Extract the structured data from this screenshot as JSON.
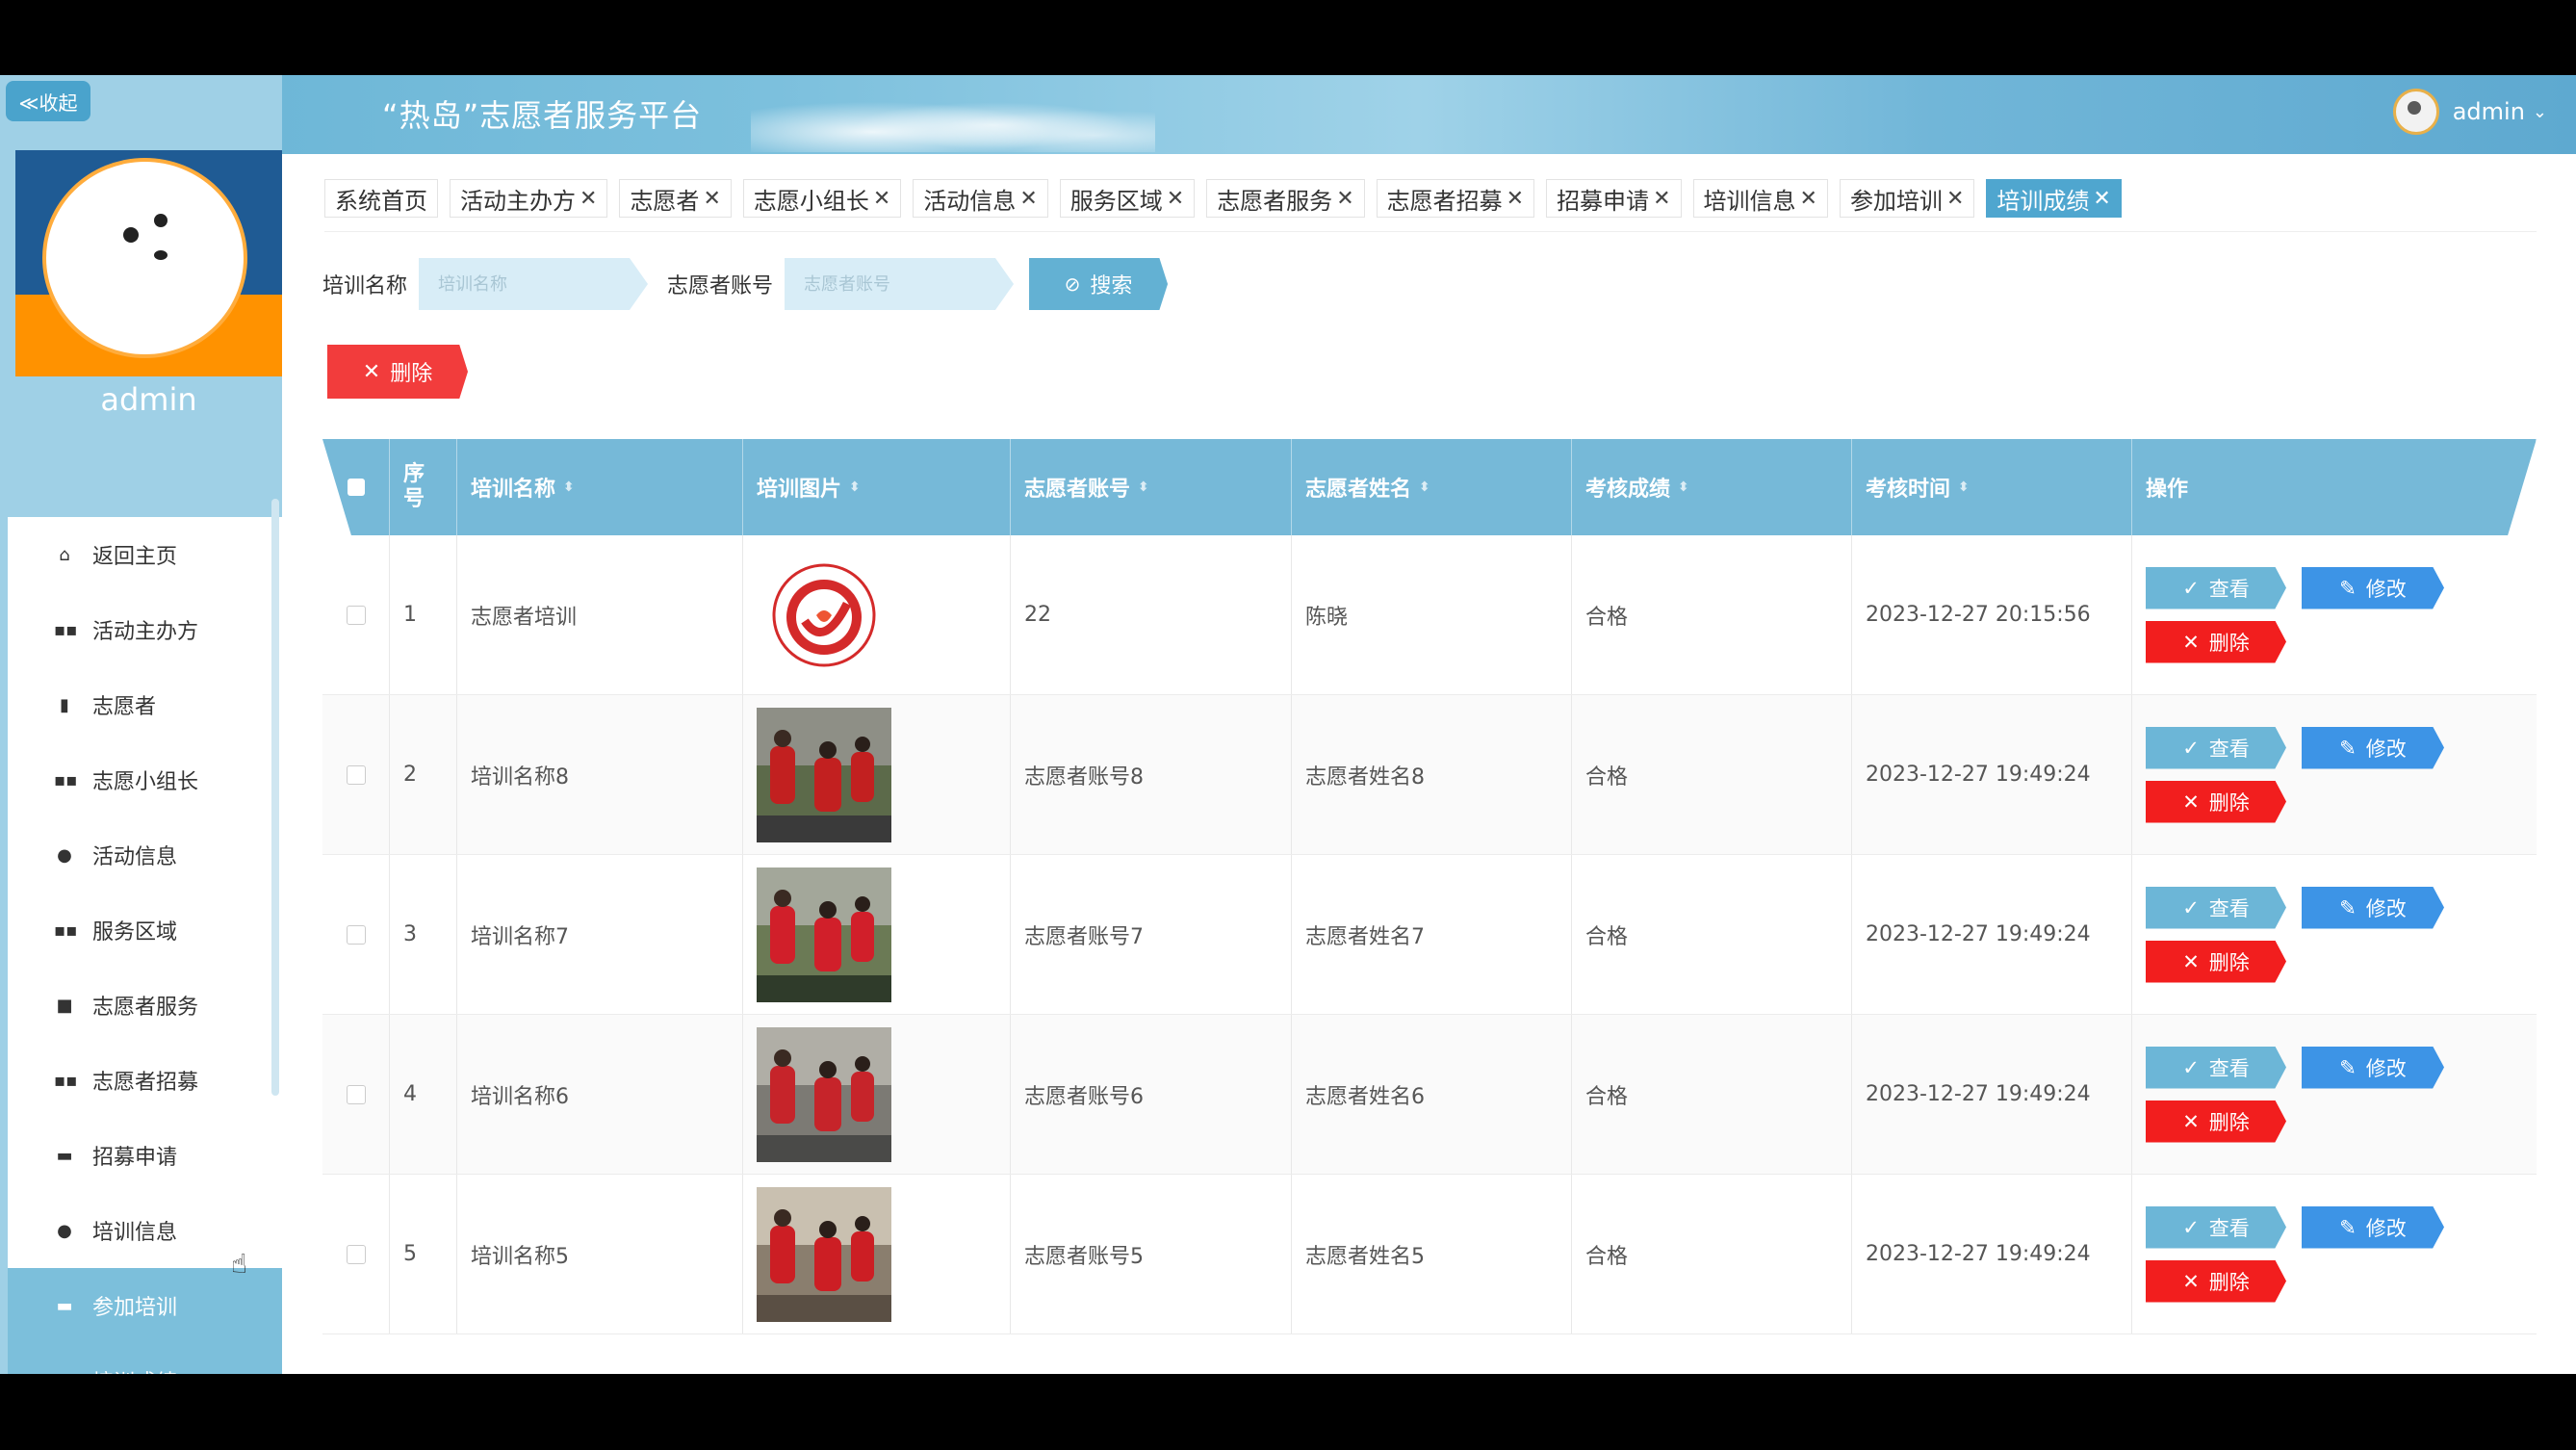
{
  "collapse_label": "≪收起",
  "brand": "“热岛”志愿者服务平台",
  "user": {
    "name": "admin",
    "caret": "⌄"
  },
  "sidebar": {
    "admin_name": "admin",
    "items": [
      {
        "label": "返回主页",
        "icon": "home-icon",
        "glyph": "⌂"
      },
      {
        "label": "活动主办方",
        "icon": "grid-icon",
        "glyph": "▪▪"
      },
      {
        "label": "志愿者",
        "icon": "chart-icon",
        "glyph": "▮"
      },
      {
        "label": "志愿小组长",
        "icon": "grid-icon",
        "glyph": "▪▪"
      },
      {
        "label": "活动信息",
        "icon": "pin-icon",
        "glyph": "●"
      },
      {
        "label": "服务区域",
        "icon": "grid-icon",
        "glyph": "▪▪"
      },
      {
        "label": "志愿者服务",
        "icon": "video-icon",
        "glyph": "■"
      },
      {
        "label": "志愿者招募",
        "icon": "grid-icon",
        "glyph": "▪▪"
      },
      {
        "label": "招募申请",
        "icon": "briefcase-icon",
        "glyph": "▬"
      },
      {
        "label": "培训信息",
        "icon": "user-icon",
        "glyph": "●"
      },
      {
        "label": "参加培训",
        "icon": "message-icon",
        "glyph": "▬"
      },
      {
        "label": "培训成绩",
        "icon": "document-icon",
        "glyph": "▮"
      }
    ]
  },
  "tabs": [
    {
      "label": "系统首页",
      "closable": false
    },
    {
      "label": "活动主办方",
      "closable": true
    },
    {
      "label": "志愿者",
      "closable": true
    },
    {
      "label": "志愿小组长",
      "closable": true
    },
    {
      "label": "活动信息",
      "closable": true
    },
    {
      "label": "服务区域",
      "closable": true
    },
    {
      "label": "志愿者服务",
      "closable": true
    },
    {
      "label": "志愿者招募",
      "closable": true
    },
    {
      "label": "招募申请",
      "closable": true
    },
    {
      "label": "培训信息",
      "closable": true
    },
    {
      "label": "参加培训",
      "closable": true
    },
    {
      "label": "培训成绩",
      "closable": true,
      "active": true
    }
  ],
  "search": {
    "name_label": "培训名称",
    "name_placeholder": "培训名称",
    "account_label": "志愿者账号",
    "account_placeholder": "志愿者账号",
    "button": "搜索"
  },
  "delete_label": "删除",
  "table": {
    "headers": [
      "序号",
      "培训名称",
      "培训图片",
      "志愿者账号",
      "志愿者姓名",
      "考核成绩",
      "考核时间",
      "操作"
    ],
    "rows": [
      {
        "no": "1",
        "name": "志愿者培训",
        "account": "22",
        "volunteer": "陈晓",
        "score": "合格",
        "time": "2023-12-27 20:15:56"
      },
      {
        "no": "2",
        "name": "培训名称8",
        "account": "志愿者账号8",
        "volunteer": "志愿者姓名8",
        "score": "合格",
        "time": "2023-12-27 19:49:24"
      },
      {
        "no": "3",
        "name": "培训名称7",
        "account": "志愿者账号7",
        "volunteer": "志愿者姓名7",
        "score": "合格",
        "time": "2023-12-27 19:49:24"
      },
      {
        "no": "4",
        "name": "培训名称6",
        "account": "志愿者账号6",
        "volunteer": "志愿者姓名6",
        "score": "合格",
        "time": "2023-12-27 19:49:24"
      },
      {
        "no": "5",
        "name": "培训名称5",
        "account": "志愿者账号5",
        "volunteer": "志愿者姓名5",
        "score": "合格",
        "time": "2023-12-27 19:49:24"
      }
    ],
    "actions": {
      "view": "查看",
      "edit": "修改",
      "delete": "删除"
    }
  },
  "colors": {
    "accent": "#4fa6cf",
    "danger": "#f21e1e",
    "edit": "#3d94e6"
  }
}
